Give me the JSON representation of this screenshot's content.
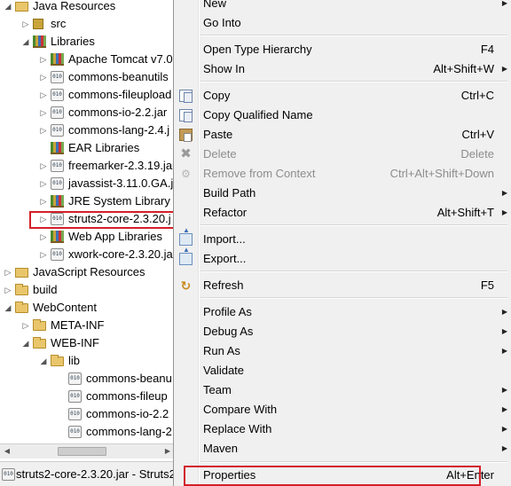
{
  "tree": {
    "rows": [
      {
        "label": "Java Resources",
        "icon": "java-resources-icon",
        "twisty": "expanded"
      },
      {
        "label": "src",
        "icon": "package-folder-icon",
        "twisty": "collapsed"
      },
      {
        "label": "Libraries",
        "icon": "libraries-icon",
        "twisty": "expanded"
      },
      {
        "label": "Apache Tomcat v7.0",
        "icon": "library-container-icon",
        "twisty": "collapsed"
      },
      {
        "label": "commons-beanutils",
        "icon": "jar-icon",
        "twisty": "collapsed"
      },
      {
        "label": "commons-fileupload",
        "icon": "jar-icon",
        "twisty": "collapsed"
      },
      {
        "label": "commons-io-2.2.jar",
        "icon": "jar-icon",
        "twisty": "collapsed"
      },
      {
        "label": "commons-lang-2.4.j",
        "icon": "jar-icon",
        "twisty": "collapsed"
      },
      {
        "label": "EAR Libraries",
        "icon": "library-container-icon",
        "twisty": "none"
      },
      {
        "label": "freemarker-2.3.19.jar",
        "icon": "jar-icon",
        "twisty": "collapsed"
      },
      {
        "label": "javassist-3.11.0.GA.ja",
        "icon": "jar-icon",
        "twisty": "collapsed"
      },
      {
        "label": "JRE System Library",
        "icon": "library-container-icon",
        "twisty": "collapsed"
      },
      {
        "label": "struts2-core-2.3.20.j",
        "icon": "jar-icon",
        "twisty": "collapsed"
      },
      {
        "label": "Web App Libraries",
        "icon": "library-container-icon",
        "twisty": "collapsed"
      },
      {
        "label": "xwork-core-2.3.20.ja",
        "icon": "jar-icon",
        "twisty": "collapsed"
      },
      {
        "label": "JavaScript Resources",
        "icon": "javascript-resources-icon",
        "twisty": "collapsed"
      },
      {
        "label": "build",
        "icon": "folder-icon",
        "twisty": "collapsed"
      },
      {
        "label": "WebContent",
        "icon": "folder-icon",
        "twisty": "expanded"
      },
      {
        "label": "META-INF",
        "icon": "folder-icon",
        "twisty": "collapsed"
      },
      {
        "label": "WEB-INF",
        "icon": "folder-icon",
        "twisty": "expanded"
      },
      {
        "label": "lib",
        "icon": "folder-icon",
        "twisty": "expanded"
      },
      {
        "label": "commons-beanu",
        "icon": "jar-icon",
        "twisty": "none"
      },
      {
        "label": "commons-fileup",
        "icon": "jar-icon",
        "twisty": "none"
      },
      {
        "label": "commons-io-2.2",
        "icon": "jar-icon",
        "twisty": "none"
      },
      {
        "label": "commons-lang-2",
        "icon": "jar-icon",
        "twisty": "none"
      }
    ],
    "selected_index": 12
  },
  "jar_glyph": "010",
  "status": {
    "text": "struts2-core-2.3.20.jar - Struts2"
  },
  "menu": {
    "items": [
      {
        "label": "New",
        "shortcut": "",
        "submenu": true,
        "disabled": false,
        "icon": ""
      },
      {
        "label": "Go Into",
        "shortcut": "",
        "submenu": false,
        "disabled": false,
        "icon": ""
      },
      {
        "sep": true
      },
      {
        "label": "Open Type Hierarchy",
        "shortcut": "F4",
        "submenu": false,
        "disabled": false,
        "icon": ""
      },
      {
        "label": "Show In",
        "shortcut": "Alt+Shift+W",
        "submenu": true,
        "disabled": false,
        "icon": ""
      },
      {
        "sep": true
      },
      {
        "label": "Copy",
        "shortcut": "Ctrl+C",
        "submenu": false,
        "disabled": false,
        "icon": "copy-icon"
      },
      {
        "label": "Copy Qualified Name",
        "shortcut": "",
        "submenu": false,
        "disabled": false,
        "icon": "copy-qualified-icon"
      },
      {
        "label": "Paste",
        "shortcut": "Ctrl+V",
        "submenu": false,
        "disabled": false,
        "icon": "paste-icon"
      },
      {
        "label": "Delete",
        "shortcut": "Delete",
        "submenu": false,
        "disabled": true,
        "icon": "delete-icon"
      },
      {
        "label": "Remove from Context",
        "shortcut": "Ctrl+Alt+Shift+Down",
        "submenu": false,
        "disabled": true,
        "icon": "remove-context-icon"
      },
      {
        "label": "Build Path",
        "shortcut": "",
        "submenu": true,
        "disabled": false,
        "icon": ""
      },
      {
        "label": "Refactor",
        "shortcut": "Alt+Shift+T",
        "submenu": true,
        "disabled": false,
        "icon": ""
      },
      {
        "sep": true
      },
      {
        "label": "Import...",
        "shortcut": "",
        "submenu": false,
        "disabled": false,
        "icon": "import-icon"
      },
      {
        "label": "Export...",
        "shortcut": "",
        "submenu": false,
        "disabled": false,
        "icon": "export-icon"
      },
      {
        "sep": true
      },
      {
        "label": "Refresh",
        "shortcut": "F5",
        "submenu": false,
        "disabled": false,
        "icon": "refresh-icon"
      },
      {
        "sep": true
      },
      {
        "label": "Profile As",
        "shortcut": "",
        "submenu": true,
        "disabled": false,
        "icon": ""
      },
      {
        "label": "Debug As",
        "shortcut": "",
        "submenu": true,
        "disabled": false,
        "icon": ""
      },
      {
        "label": "Run As",
        "shortcut": "",
        "submenu": true,
        "disabled": false,
        "icon": ""
      },
      {
        "label": "Validate",
        "shortcut": "",
        "submenu": false,
        "disabled": false,
        "icon": ""
      },
      {
        "label": "Team",
        "shortcut": "",
        "submenu": true,
        "disabled": false,
        "icon": ""
      },
      {
        "label": "Compare With",
        "shortcut": "",
        "submenu": true,
        "disabled": false,
        "icon": ""
      },
      {
        "label": "Replace With",
        "shortcut": "",
        "submenu": true,
        "disabled": false,
        "icon": ""
      },
      {
        "label": "Maven",
        "shortcut": "",
        "submenu": true,
        "disabled": false,
        "icon": ""
      },
      {
        "sep": true
      },
      {
        "label": "Properties",
        "shortcut": "Alt+Enter",
        "submenu": false,
        "disabled": false,
        "icon": ""
      }
    ],
    "highlighted_index": 28
  },
  "colors": {
    "highlight_border": "#d31f2a",
    "menu_background": "#f0f0f0",
    "disabled_text": "#8d8d8d"
  }
}
